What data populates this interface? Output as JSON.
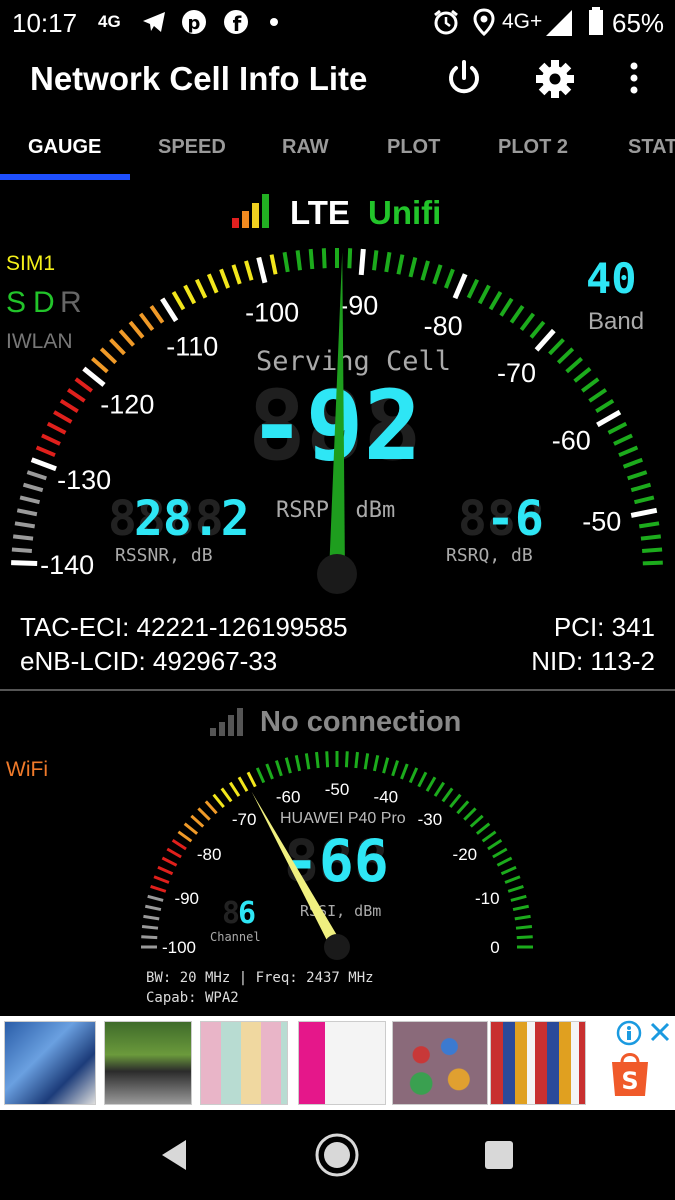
{
  "status_bar": {
    "time": "10:17",
    "net_small": "4G",
    "net_right": "4G+",
    "battery": "65%",
    "icons": [
      "telegram-icon",
      "pinterest-icon",
      "facebook-icon",
      "dot-icon",
      "alarm-icon",
      "location-icon",
      "signal-icon",
      "battery-icon"
    ]
  },
  "app_bar": {
    "title": "Network Cell Info Lite",
    "icons": [
      "power-icon",
      "gear-icon",
      "more-vert-icon"
    ]
  },
  "tabs": [
    {
      "label": "GAUGE",
      "active": true
    },
    {
      "label": "SPEED",
      "active": false
    },
    {
      "label": "RAW",
      "active": false
    },
    {
      "label": "PLOT",
      "active": false
    },
    {
      "label": "PLOT 2",
      "active": false
    },
    {
      "label": "STAT",
      "active": false
    }
  ],
  "cell": {
    "tech": "LTE",
    "operator": "Unifi",
    "sim": "SIM1",
    "sdr": {
      "s": "S",
      "d": "D",
      "r": "R"
    },
    "iwlan": "IWLAN",
    "band_value": "40",
    "band_label": "Band",
    "serving_label": "Serving Cell",
    "rsrp_value": "-92",
    "rsrp_label": "RSRP, dBm",
    "rssnr_value": "28.2",
    "rssnr_label": "RSSNR, dB",
    "rsrq_value": "-6",
    "rsrq_label": "RSRQ, dB",
    "tac_eci": "TAC-ECI: 42221-126199585",
    "enb_lcid": "eNB-LCID: 492967-33",
    "pci": "PCI: 341",
    "nid": "NID: 113-2",
    "gauge_ticks": [
      "-140",
      "-130",
      "-120",
      "-110",
      "-100",
      "-90",
      "-80",
      "-70",
      "-60",
      "-50"
    ],
    "gauge_min": -140,
    "gauge_max": -45,
    "needle_value": -92,
    "colors": {
      "red": "#e0201c",
      "orange": "#f09a28",
      "yellow": "#f2e61c",
      "green": "#1cab1c",
      "grey": "#9a9a9a",
      "cyan": "#2ee6f5",
      "operator": "#22c42a",
      "sim": "#f4f01a"
    }
  },
  "wifi": {
    "label": "WiFi",
    "status": "No connection",
    "device": "HUAWEI P40 Pro",
    "rssi_value": "-66",
    "rssi_label": "RSSI, dBm",
    "channel_value": "6",
    "channel_label": "Channel",
    "bw_freq": "BW: 20 MHz | Freq: 2437 MHz",
    "capab": "Capab: WPA2",
    "gauge_ticks": [
      "-100",
      "-90",
      "-80",
      "-70",
      "-60",
      "-50",
      "-40",
      "-30",
      "-20",
      "-10",
      "0"
    ],
    "gauge_min": -100,
    "gauge_max": 0,
    "needle_value": -66,
    "colors": {
      "label": "#f07a2a",
      "needle": "#f0f080"
    }
  },
  "ad": {
    "icons": [
      "info-icon",
      "close-icon",
      "shopee-icon"
    ]
  },
  "nav": {
    "icons": [
      "back-icon",
      "home-icon",
      "recents-icon"
    ]
  }
}
